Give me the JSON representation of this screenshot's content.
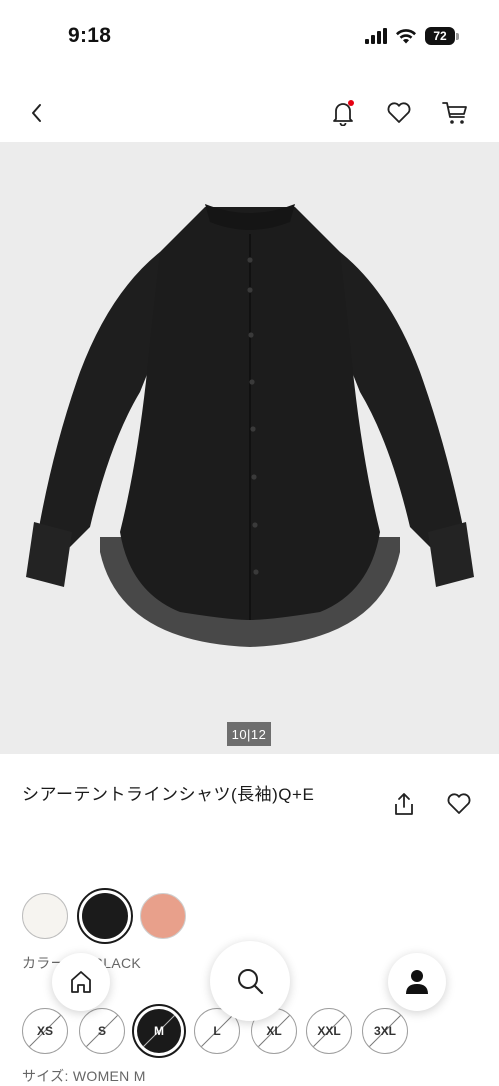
{
  "status_bar": {
    "time": "9:18",
    "battery": "72"
  },
  "header": {
    "back_icon": "chevron-left-icon",
    "notification_icon": "bell-icon",
    "favorites_icon": "heart-icon",
    "cart_icon": "cart-icon",
    "notification_dot_color": "#e60012"
  },
  "product": {
    "image_counter": "10|12",
    "title": "シアーテントラインシャツ(長袖)Q+E",
    "share_icon": "share-icon",
    "favorite_icon": "heart-icon"
  },
  "colors": {
    "label": "カラー: 09 BLACK",
    "swatches": [
      {
        "name": "white",
        "hex": "#f6f4f0",
        "selected": false
      },
      {
        "name": "black",
        "hex": "#1b1b1b",
        "selected": true
      },
      {
        "name": "pink",
        "hex": "#e8a08b",
        "selected": false
      }
    ]
  },
  "sizes": {
    "label": "サイズ: WOMEN M",
    "options": [
      {
        "label": "XS",
        "available": false,
        "selected": false
      },
      {
        "label": "S",
        "available": false,
        "selected": false
      },
      {
        "label": "M",
        "available": false,
        "selected": true
      },
      {
        "label": "L",
        "available": false,
        "selected": false
      },
      {
        "label": "XL",
        "available": false,
        "selected": false
      },
      {
        "label": "XXL",
        "available": false,
        "selected": false
      },
      {
        "label": "3XL",
        "available": false,
        "selected": false
      }
    ]
  },
  "bottom_nav": {
    "items": [
      {
        "icon": "home-icon"
      },
      {
        "icon": "search-icon"
      },
      {
        "icon": "account-icon"
      }
    ]
  }
}
